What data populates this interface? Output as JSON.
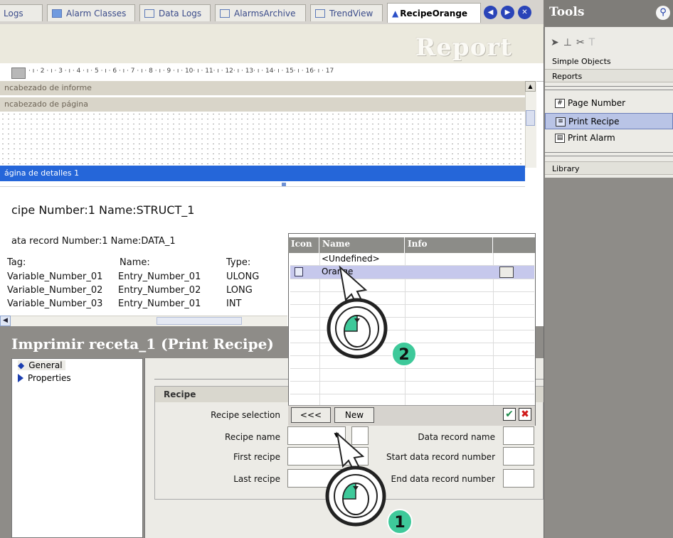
{
  "tabs": [
    {
      "label": "Logs",
      "active": false
    },
    {
      "label": "Alarm Classes",
      "active": false
    },
    {
      "label": "Data Logs",
      "active": false
    },
    {
      "label": "AlarmsArchive",
      "active": false
    },
    {
      "label": "TrendView",
      "active": false
    },
    {
      "label": "RecipeOrange",
      "active": true
    }
  ],
  "report": {
    "title": "Report",
    "ruler_text": "· ı · 2 · ı · 3 · ı · 4 · ı · 5 · ı · 6 · ı · 7 · ı · 8 · ı · 9 · ı · 10· ı · 11· ı · 12· ı · 13· ı · 14· ı · 15· ı · 16· ı · 17",
    "band_report_header": "ncabezado de informe",
    "band_page_header": "ncabezado de página",
    "band_detail": "ágina de detalles 1",
    "recipe_line": "cipe Number:1 Name:STRUCT_1",
    "data_record_line": "ata record Number:1 Name:DATA_1",
    "columns": [
      "Tag:",
      "Name:",
      "Type:"
    ],
    "rows": [
      [
        "Variable_Number_01",
        "Entry_Number_01",
        "ULONG"
      ],
      [
        "Variable_Number_02",
        "Entry_Number_02",
        "LONG"
      ],
      [
        "Variable_Number_03",
        "Entry_Number_01",
        "INT"
      ]
    ]
  },
  "properties": {
    "title": "Imprimir receta_1 (Print Recipe)",
    "tree": [
      "General",
      "Properties"
    ],
    "group_title": "Recipe",
    "left_labels": [
      "Recipe selection",
      "Recipe name",
      "First recipe",
      "Last recipe"
    ],
    "right_labels": [
      "Data record name",
      "Start data record number",
      "End data record number"
    ]
  },
  "popup": {
    "headers": [
      "Icon",
      "Name",
      "Info",
      ""
    ],
    "rows": [
      "<Undefined>",
      "Orange"
    ],
    "back_button": "<<<",
    "new_button": "New"
  },
  "tools": {
    "title": "Tools",
    "sections": [
      "Simple Objects",
      "Reports",
      "Library"
    ],
    "items": [
      "Page Number",
      "Print Recipe",
      "Print Alarm"
    ]
  },
  "steps": [
    "1",
    "2"
  ],
  "colors": {
    "accent": "#2566d9",
    "panel": "#8e8c88",
    "step_badge": "#3ec99a"
  }
}
